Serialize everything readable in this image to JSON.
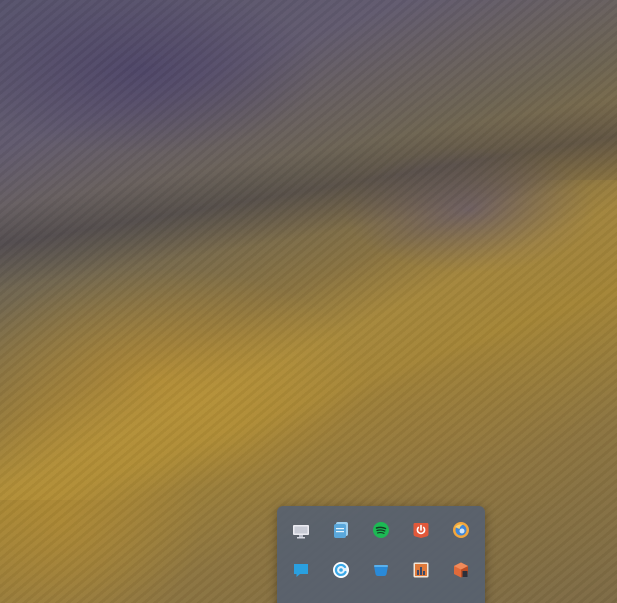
{
  "desktop": {
    "wallpaper": "mountain-forest-landscape"
  },
  "app_drawer": {
    "background": "#546072",
    "rows": [
      [
        {
          "name": "display-settings-icon",
          "color": "#e8e8ee"
        },
        {
          "name": "files-icon",
          "color": "#6ab2e0"
        },
        {
          "name": "spotify-icon",
          "color": "#1db954"
        },
        {
          "name": "power-icon",
          "color": "#e2583a"
        },
        {
          "name": "browser-icon",
          "color": "#f0a040"
        }
      ],
      [
        {
          "name": "chat-icon",
          "color": "#2aa0e0"
        },
        {
          "name": "sync-icon",
          "color": "#3aa8e8"
        },
        {
          "name": "app-store-icon",
          "color": "#2a8ad8"
        },
        {
          "name": "monitor-app-icon",
          "color": "#e07a3a"
        },
        {
          "name": "package-icon",
          "color": "#e06a3a"
        }
      ]
    ]
  }
}
